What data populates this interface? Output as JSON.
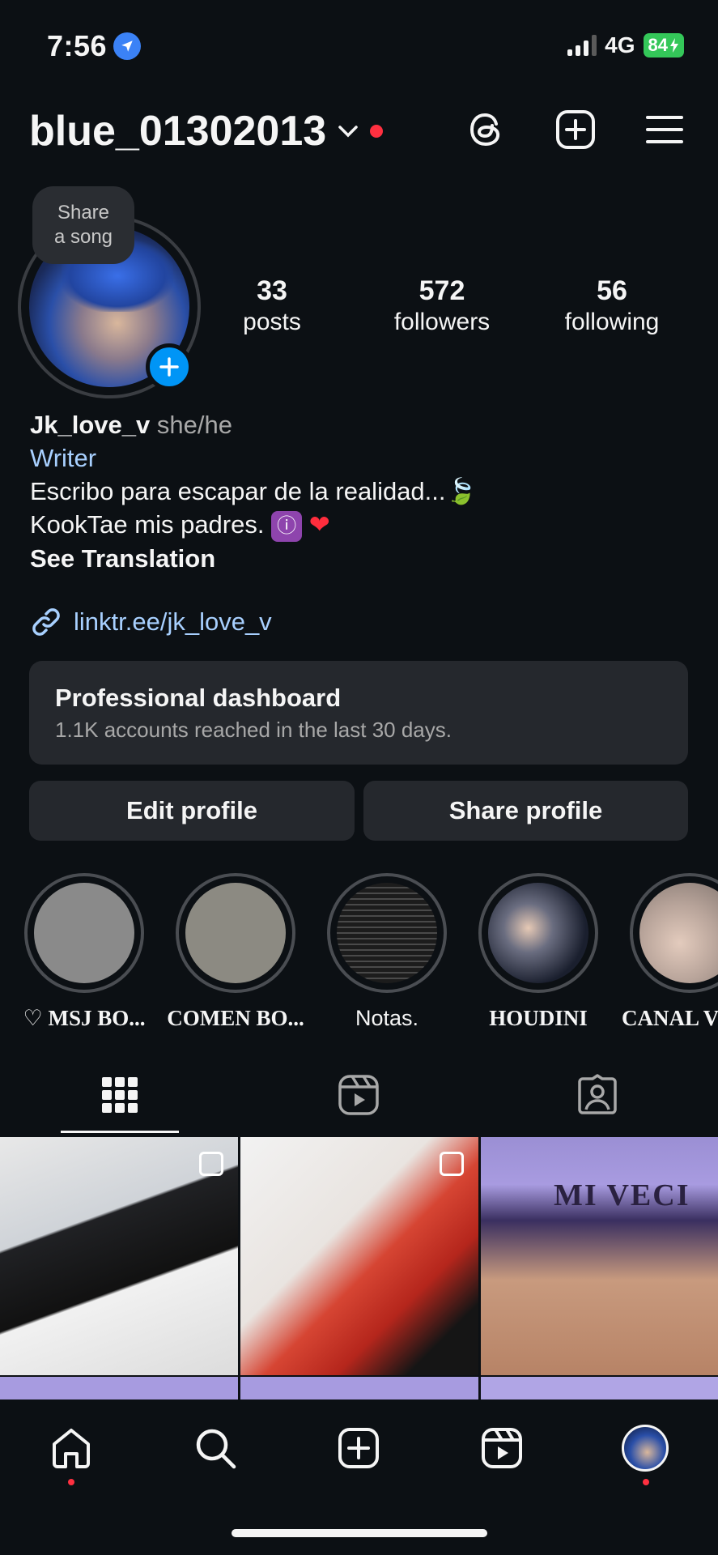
{
  "status_bar": {
    "time": "7:56",
    "network": "4G",
    "battery": "84"
  },
  "header": {
    "username": "blue_01302013"
  },
  "profile": {
    "song_bubble": [
      "Share",
      "a song"
    ],
    "stats": [
      {
        "num": "33",
        "label": "posts"
      },
      {
        "num": "572",
        "label": "followers"
      },
      {
        "num": "56",
        "label": "following"
      }
    ],
    "name": "Jk_love_v",
    "pronouns": "she/he",
    "category": "Writer",
    "bio_line1": "Escribo para escapar de la realidad...",
    "bio_line2": "KookTae mis padres.",
    "see_translation": "See Translation",
    "link": "linktr.ee/jk_love_v"
  },
  "dashboard": {
    "title": "Professional dashboard",
    "subtitle": "1.1K accounts reached in the last 30 days."
  },
  "buttons": {
    "edit": "Edit profile",
    "share": "Share profile"
  },
  "highlights": [
    {
      "label": "♡ MSJ BO...",
      "color": "#8a8a8a"
    },
    {
      "label": "COMEN BO...",
      "color": "#8c8a82"
    },
    {
      "label": "Notas.",
      "color": "#1c1c1c"
    },
    {
      "label": "HOUDINI",
      "color": "#2c3548"
    },
    {
      "label": "CANAL V",
      "color": "#c9b2a6"
    }
  ],
  "posts": {
    "post3_title": "MI VECI"
  },
  "colors": {
    "background": "#0c1014",
    "accent_blue": "#0095f6",
    "link_blue": "#a8d0ff",
    "notification_red": "#ff3040"
  }
}
